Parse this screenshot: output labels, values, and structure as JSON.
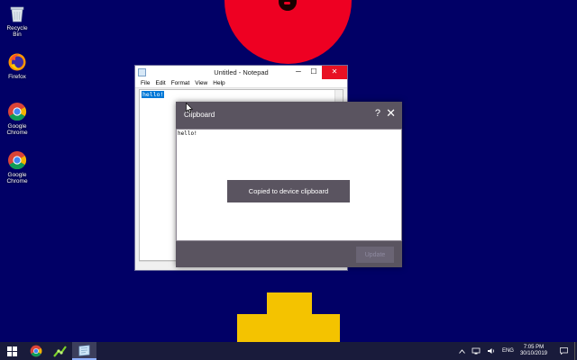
{
  "desktop": {
    "icons": [
      {
        "name": "recycle-bin",
        "label": "Recycle Bin"
      },
      {
        "name": "firefox",
        "label": "Firefox"
      },
      {
        "name": "google-chrome-1",
        "label": "Google Chrome"
      },
      {
        "name": "google-chrome-2",
        "label": "Google Chrome"
      }
    ]
  },
  "notepad": {
    "title": "Untitled - Notepad",
    "menu": [
      "File",
      "Edit",
      "Format",
      "View",
      "Help"
    ],
    "content": "hello!",
    "controls": {
      "minimize": "─",
      "maximize": "☐",
      "close": "✕"
    }
  },
  "clipboard_dialog": {
    "title": "Clipboard",
    "help": "?",
    "close": "✕",
    "content": "hello!",
    "toast": "Copied to device clipboard",
    "update_button": "Update"
  },
  "taskbar": {
    "pinned": [
      "start-button",
      "chrome",
      "green-app",
      "explorer-window"
    ],
    "language": "ENG",
    "time": "7:05 PM",
    "date": "30/10/2019"
  },
  "colors": {
    "desktop_bg": "#010066",
    "red_circle": "#ee0022",
    "yellow_shape": "#f4c300",
    "dialog_bg": "#5a5460",
    "selection": "#0078d7"
  }
}
